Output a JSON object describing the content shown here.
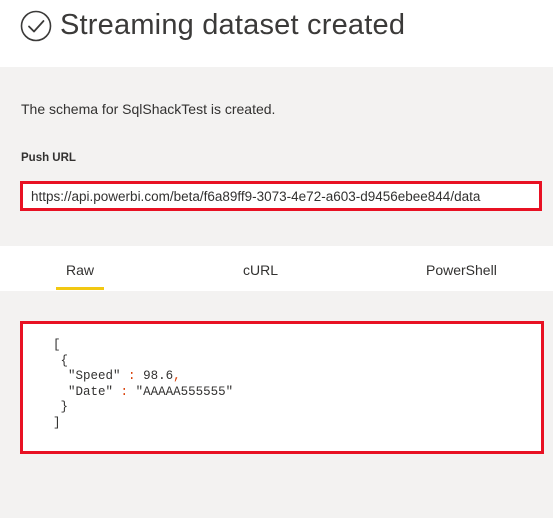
{
  "header": {
    "title": "Streaming dataset created",
    "icon": "check-circle-icon"
  },
  "panel": {
    "schema_message": "The schema for SqlShackTest is created.",
    "push_url_label": "Push URL",
    "push_url_value": "https://api.powerbi.com/beta/f6a89ff9-3073-4e72-a603-d9456ebee844/data"
  },
  "tabs": [
    {
      "label": "Raw",
      "selected": true
    },
    {
      "label": "cURL",
      "selected": false
    },
    {
      "label": "PowerShell",
      "selected": false
    }
  ],
  "code": {
    "open_bracket": "[",
    "open_brace": "{",
    "speed_key": "\"Speed\"",
    "speed_value": "98.6",
    "date_key": "\"Date\"",
    "date_value": "\"AAAAA555555\"",
    "close_brace": "}",
    "close_bracket": "]"
  },
  "colors": {
    "highlight_border": "#e81123",
    "tab_underline": "#f2c811",
    "panel_bg": "#f3f2f1"
  }
}
